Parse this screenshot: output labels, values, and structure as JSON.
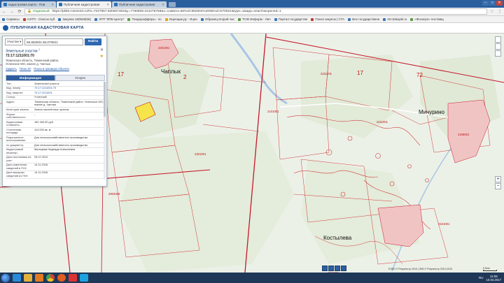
{
  "browser": {
    "tabs": [
      {
        "label": "кадастровая карта - Пои",
        "active": false
      },
      {
        "label": "Публичная кадастровая",
        "active": true
      },
      {
        "label": "Публичная кадастровая",
        "active": false
      }
    ],
    "secure_label": "Надежный",
    "url": "https://pkk5.rosreestr.ru/#x=7247957.830607302&y=7750808.312278758&z=14&text=56%2C962604%2065%2C070921&type=1&app=search&opened=1",
    "bookmarks": [
      {
        "label": "Сервисы",
        "color": "b"
      },
      {
        "label": "АЭТП - Список пуб",
        "color": "r"
      },
      {
        "label": "Закупки 150528(06)",
        "color": "b"
      },
      {
        "label": "ЭТП \"ВТБ-Центр\"",
        "color": "b"
      },
      {
        "label": "Тендерофферы - по",
        "color": "g"
      },
      {
        "label": "Оценщик.ру - Оцен",
        "color": ""
      },
      {
        "label": "Образец второй час",
        "color": "b"
      },
      {
        "label": "ТСЖ Информ - Лич",
        "color": "g"
      },
      {
        "label": "Портал государстве",
        "color": "b"
      },
      {
        "label": "Поиск закупок | СТА",
        "color": "r"
      },
      {
        "label": "Все государственн",
        "color": "b"
      },
      {
        "label": "ISI-Zakupki.ru",
        "color": "b"
      },
      {
        "label": "«Фосагро» поставщ",
        "color": "g"
      }
    ]
  },
  "app": {
    "title": "ПУБЛИЧНАЯ КАДАСТРОВАЯ КАРТА"
  },
  "search": {
    "type_label": "Участки",
    "query": "56,962604 65,070921",
    "find_label": "Найти"
  },
  "panel": {
    "section_title": "Земельные участки",
    "section_count": "1",
    "result_number": "72:17:1211001:70",
    "result_address": "Тюменская область, Тюменский район, Успенское МО, южнее д. Чаплык",
    "links": [
      "Ударить",
      "План ЗУ",
      "Показ в границах объекта"
    ],
    "tabs": [
      {
        "label": "Информация",
        "active": true
      },
      {
        "label": "Услуги",
        "active": false
      }
    ],
    "rows": [
      {
        "k": "Тип:",
        "v": "Земельный участок"
      },
      {
        "k": "Кад. номер:",
        "v": "72:17:1211001:70",
        "link": true
      },
      {
        "k": "Кад. квартал:",
        "v": "72:17:1211001",
        "link": true
      },
      {
        "k": "Статус:",
        "v": "Учтенный"
      },
      {
        "k": "Адрес:",
        "v": "Тюменская область, Тюменский район, Успенское МО, южнее д. Чаплык"
      },
      {
        "k": "Категория земель:",
        "v": "Земли населённых пунктов"
      },
      {
        "k": "Форма собственности:",
        "v": "-"
      },
      {
        "k": "Кадастровая стоимость:",
        "v": "182 400,00 руб."
      },
      {
        "k": "Уточненная площадь:",
        "v": "114 000 кв. м"
      },
      {
        "k": "Разрешенное использование:",
        "v": "Для сельскохозяйственного производства"
      },
      {
        "k": "по документу:",
        "v": "Для сельскохозяйственного производства"
      },
      {
        "k": "Кадастровый инженер:",
        "v": "Мальцева Надежда Алексеевна"
      },
      {
        "k": "Дата постановки на учет:",
        "v": "25.07.2012"
      },
      {
        "k": "Дата изменения сведений в ГКН:",
        "v": "14.11.2016"
      },
      {
        "k": "Дата выгрузки сведений из ГКН:",
        "v": "14.11.2016"
      }
    ]
  },
  "map": {
    "places": [
      "Чаплык",
      "Мичурино",
      "Костылева"
    ],
    "region_numbers": [
      "17",
      "72",
      "17",
      "2"
    ],
    "cadastral_labels": [
      "2211001",
      "2211001",
      "2211001",
      "2101001",
      "2301001",
      "2301001",
      "2108001",
      "2904006",
      "2101001"
    ],
    "copyright": "ЕЭКО © Росреестр 2010 | ЛКБ © Росреестр 2010-2015",
    "scale": "0,5км"
  },
  "taskbar": {
    "lang": "RU",
    "time": "12:08",
    "date": "10.04.2017"
  }
}
